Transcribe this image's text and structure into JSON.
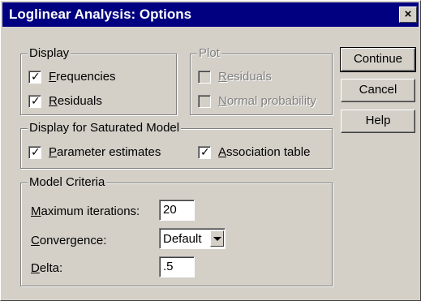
{
  "window": {
    "title": "Loglinear Analysis: Options",
    "close_glyph": "×"
  },
  "display": {
    "legend": "Display",
    "frequencies": {
      "first": "F",
      "rest": "requencies",
      "checked": true
    },
    "residuals": {
      "first": "R",
      "rest": "esiduals",
      "checked": true
    }
  },
  "plot": {
    "legend": "Plot",
    "residuals": {
      "first": "R",
      "rest": "esiduals",
      "checked": false
    },
    "normal_probability": {
      "first": "N",
      "rest": "ormal probability",
      "checked": false
    }
  },
  "saturated": {
    "legend": "Display for Saturated Model",
    "parameter_estimates": {
      "first": "P",
      "rest": "arameter estimates",
      "checked": true
    },
    "association_table": {
      "first": "A",
      "rest": "ssociation table",
      "checked": true
    }
  },
  "criteria": {
    "legend": "Model Criteria",
    "max_iterations": {
      "first": "M",
      "rest": "aximum iterations:",
      "value": "20"
    },
    "convergence": {
      "first": "C",
      "rest": "onvergence:",
      "value": "Default"
    },
    "delta": {
      "first": "D",
      "rest": "elta:",
      "value": ".5"
    }
  },
  "buttons": {
    "continue": "Continue",
    "cancel": "Cancel",
    "help": "Help"
  },
  "check_glyph": "✓"
}
